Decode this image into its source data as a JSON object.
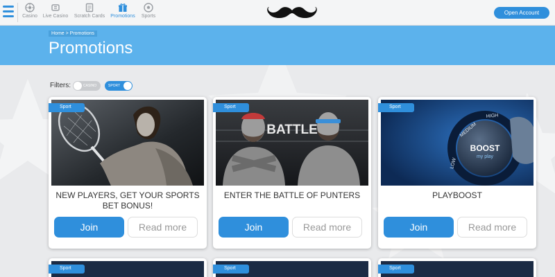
{
  "nav": {
    "menu_icon": "hamburger-icon",
    "items": [
      {
        "label": "Casino",
        "icon": "roulette-icon",
        "active": false
      },
      {
        "label": "Live Casino",
        "icon": "live-dealer-icon",
        "active": false
      },
      {
        "label": "Scratch Cards",
        "icon": "scratch-card-icon",
        "active": false
      },
      {
        "label": "Promotions",
        "icon": "gift-icon",
        "active": true
      },
      {
        "label": "Sports",
        "icon": "football-icon",
        "active": false
      }
    ],
    "logo": "mustache-logo",
    "open_account": "Open Account"
  },
  "banner": {
    "breadcrumb": "Home > Promotions",
    "title": "Promotions"
  },
  "filters": {
    "label": "Filters:",
    "casino": {
      "label": "CASINO",
      "on": false
    },
    "sport": {
      "label": "SPORT",
      "on": true
    }
  },
  "cards": [
    {
      "tag": "Sport",
      "title": "NEW PLAYERS, GET YOUR SPORTS BET BONUS!",
      "join": "Join",
      "more": "Read more",
      "image": "tennis-player"
    },
    {
      "tag": "Sport",
      "title": "ENTER THE BATTLE OF PUNTERS",
      "image_text": "BATTLE",
      "join": "Join",
      "more": "Read more",
      "image": "two-bearded-men"
    },
    {
      "tag": "Sport",
      "title": "PLAYBOOST",
      "image_text": [
        "BOOST",
        "my play"
      ],
      "dial_labels": [
        "LOW",
        "MEDIUM",
        "HIGH"
      ],
      "join": "Join",
      "more": "Read more",
      "image": "boost-dial"
    }
  ],
  "cards_row2": [
    {
      "tag": "Sport"
    },
    {
      "tag": "Sport"
    },
    {
      "tag": "Sport"
    }
  ],
  "colors": {
    "accent": "#2f8fdc",
    "banner": "#5cb2ec",
    "background": "#e9eaec",
    "topbar": "#f4f5f6"
  }
}
